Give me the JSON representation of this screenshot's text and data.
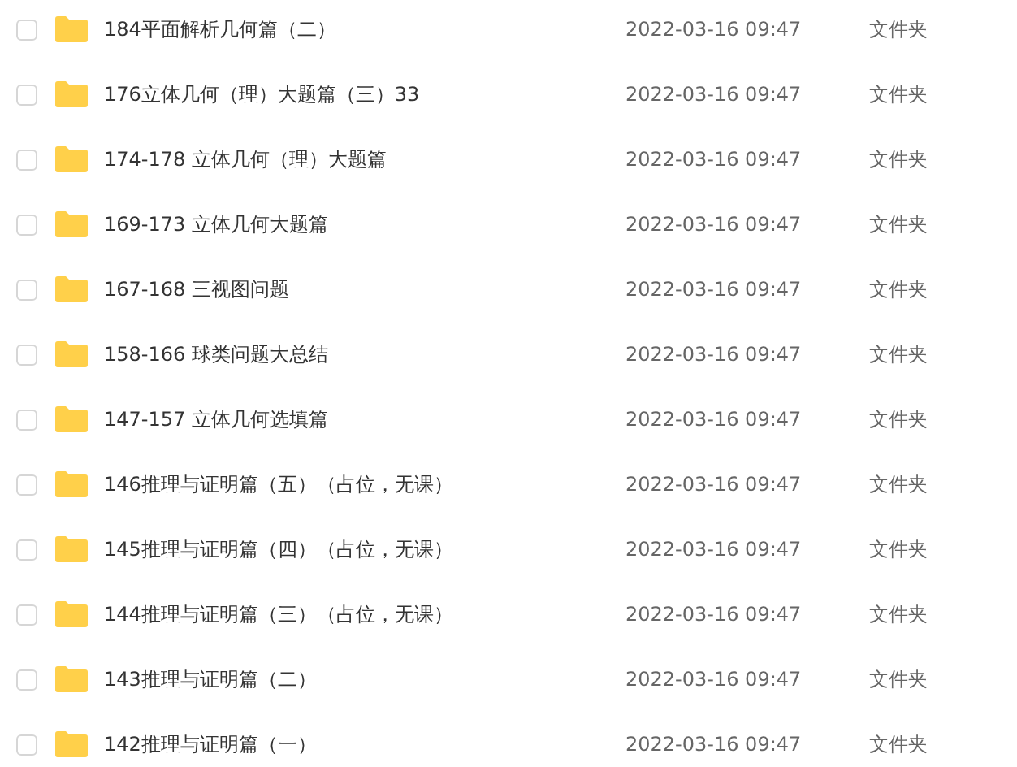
{
  "files": [
    {
      "name": "184平面解析几何篇（二）",
      "modified": "2022-03-16 09:47",
      "type": "文件夹",
      "checked": false
    },
    {
      "name": "176立体几何（理）大题篇（三）33",
      "modified": "2022-03-16 09:47",
      "type": "文件夹",
      "checked": false
    },
    {
      "name": "174-178 立体几何（理）大题篇",
      "modified": "2022-03-16 09:47",
      "type": "文件夹",
      "checked": false
    },
    {
      "name": "169-173 立体几何大题篇",
      "modified": "2022-03-16 09:47",
      "type": "文件夹",
      "checked": false
    },
    {
      "name": "167-168 三视图问题",
      "modified": "2022-03-16 09:47",
      "type": "文件夹",
      "checked": false
    },
    {
      "name": "158-166 球类问题大总结",
      "modified": "2022-03-16 09:47",
      "type": "文件夹",
      "checked": false
    },
    {
      "name": "147-157 立体几何选填篇",
      "modified": "2022-03-16 09:47",
      "type": "文件夹",
      "checked": false
    },
    {
      "name": "146推理与证明篇（五）（占位，无课）",
      "modified": "2022-03-16 09:47",
      "type": "文件夹",
      "checked": false
    },
    {
      "name": "145推理与证明篇（四）（占位，无课）",
      "modified": "2022-03-16 09:47",
      "type": "文件夹",
      "checked": false
    },
    {
      "name": "144推理与证明篇（三）（占位，无课）",
      "modified": "2022-03-16 09:47",
      "type": "文件夹",
      "checked": false
    },
    {
      "name": "143推理与证明篇（二）",
      "modified": "2022-03-16 09:47",
      "type": "文件夹",
      "checked": false
    },
    {
      "name": "142推理与证明篇（一）",
      "modified": "2022-03-16 09:47",
      "type": "文件夹",
      "checked": false
    }
  ]
}
